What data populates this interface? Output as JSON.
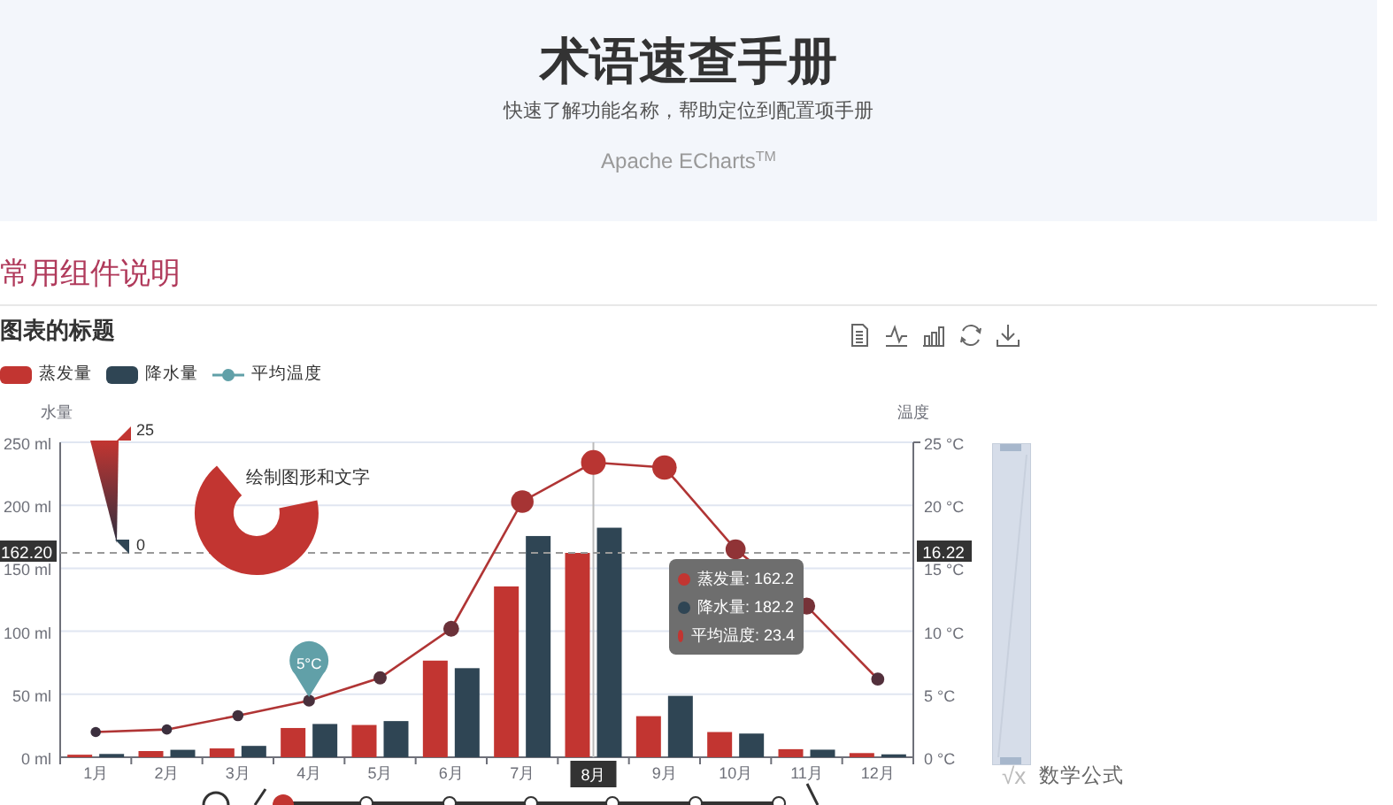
{
  "header": {
    "title": "术语速查手册",
    "subtitle": "快速了解功能名称，帮助定位到配置项手册",
    "brand": "Apache ECharts$^{TM}$"
  },
  "section": {
    "title": "常用组件说明"
  },
  "chart_panel": {
    "title": "图表的标题",
    "legend": [
      {
        "kind": "bar",
        "color": "#c23531"
      },
      {
        "kind": "bar",
        "color": "#2f4554"
      },
      {
        "kind": "line",
        "color": "#61a0a8"
      }
    ],
    "mark_line": {
      "labels": [
        "162.20",
        "16.22"
      ]
    },
    "chart_data": {
      "type": "bar",
      "grid": true,
      "stacked": false,
      "categories": [
        "1月",
        "2月",
        "3月",
        "4月",
        "5月",
        "6月",
        "7月",
        "8月",
        "9月",
        "10月",
        "11月",
        "12月"
      ],
      "ylabel": "水量",
      "ylim": [
        0,
        250
      ],
      "yticks": [
        {
          "value": 0,
          "label": "0 ml"
        },
        {
          "value": 50,
          "label": "50 ml"
        },
        {
          "value": 100,
          "label": "100 ml"
        },
        {
          "value": 150,
          "label": "150 ml"
        },
        {
          "value": 200,
          "label": "200 ml"
        },
        {
          "value": 250,
          "label": "250 ml"
        }
      ],
      "series": [
        {
          "name": "蒸发量",
          "color": "#c23531",
          "values": [
            2.0,
            4.9,
            7.0,
            23.2,
            25.6,
            76.7,
            135.6,
            162.2,
            32.6,
            20.0,
            6.4,
            3.3
          ]
        },
        {
          "name": "降水量",
          "color": "#2f4554",
          "values": [
            2.6,
            5.9,
            9.0,
            26.4,
            28.7,
            70.7,
            175.6,
            182.2,
            48.7,
            18.8,
            6.0,
            2.3
          ]
        }
      ],
      "annotations": [
        {
          "x": "8月"
        }
      ]
    },
    "temperature_axis": {
      "chart_data": {
        "type": "line",
        "categories": [
          null,
          null,
          null,
          null,
          null,
          null,
          null,
          null,
          null,
          null,
          null,
          null
        ],
        "ylabel": "温度",
        "ylim": [
          0,
          25
        ],
        "yticks": [
          {
            "value": 0,
            "label": "0 °C"
          },
          {
            "value": 5,
            "label": "5 °C"
          },
          {
            "value": 10,
            "label": "10 °C"
          },
          {
            "value": 15,
            "label": "15 °C"
          },
          {
            "value": 20,
            "label": "20 °C"
          },
          {
            "value": 25,
            "label": "25 °C"
          }
        ],
        "series": [
          {
            "name": "平均温度",
            "color": "#b03535",
            "marker": true,
            "values": [
              2.0,
              2.2,
              3.3,
              4.5,
              6.3,
              10.2,
              20.3,
              23.4,
              23.0,
              16.5,
              12.0,
              6.2
            ]
          }
        ],
        "annotations": [
          {
            "y": 4.5,
            "text": "5°C"
          }
        ]
      }
    },
    "data_zoom": {
      "level": 1
    },
    "visual_map": {
      "max_label": "25",
      "min_label": "0"
    },
    "graphic": {
      "text": "绘制图形和文字"
    },
    "tooltip": {
      "items": [
        {
          "text": "蒸发量: 162.2",
          "color": "#c23531"
        },
        {
          "text": "降水量: 182.2",
          "color": "#2f4554"
        },
        {
          "text": "平均温度: 23.4",
          "color": "#c23531"
        }
      ]
    },
    "formula": {
      "icon": "√x",
      "label": "数学公式"
    }
  }
}
